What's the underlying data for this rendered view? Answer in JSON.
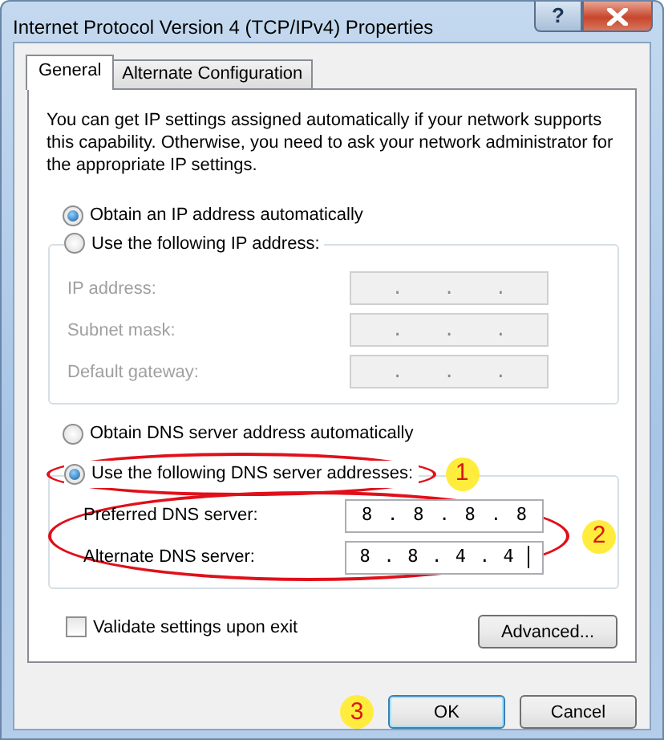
{
  "window": {
    "title": "Internet Protocol Version 4 (TCP/IPv4) Properties",
    "help_button": "?"
  },
  "tabs": [
    {
      "label": "General",
      "selected": true
    },
    {
      "label": "Alternate Configuration",
      "selected": false
    }
  ],
  "intro": "You can get IP settings assigned automatically if your network supports this capability. Otherwise, you need to ask your network administrator for the appropriate IP settings.",
  "ip_mode": [
    {
      "label": "Obtain an IP address automatically",
      "selected": true
    },
    {
      "label": "Use the following IP address:",
      "selected": false
    }
  ],
  "ip_fields": [
    {
      "label": "IP address:",
      "disabled": true,
      "parts": [
        ".",
        ".",
        "."
      ]
    },
    {
      "label": "Subnet mask:",
      "disabled": true,
      "parts": [
        ".",
        ".",
        "."
      ]
    },
    {
      "label": "Default gateway:",
      "disabled": true,
      "parts": [
        ".",
        ".",
        "."
      ]
    }
  ],
  "dns_mode": [
    {
      "label": "Obtain DNS server address automatically",
      "selected": false
    },
    {
      "label": "Use the following DNS server addresses:",
      "selected": true,
      "callout": "1"
    }
  ],
  "dns_group": {
    "callout": "2"
  },
  "dns_fields": [
    {
      "label": "Preferred DNS server:",
      "disabled": false,
      "focused": false,
      "parts": [
        "8",
        ".",
        "8",
        ".",
        "8",
        ".",
        "8"
      ]
    },
    {
      "label": "Alternate DNS server:",
      "disabled": false,
      "focused": true,
      "parts": [
        "8",
        ".",
        "8",
        ".",
        "4",
        ".",
        "4"
      ]
    }
  ],
  "validate": {
    "label": "Validate settings upon exit",
    "checked": false
  },
  "advanced_button": "Advanced...",
  "buttons": [
    {
      "label": "OK",
      "default": true,
      "callout": "3"
    },
    {
      "label": "Cancel",
      "default": false
    }
  ]
}
